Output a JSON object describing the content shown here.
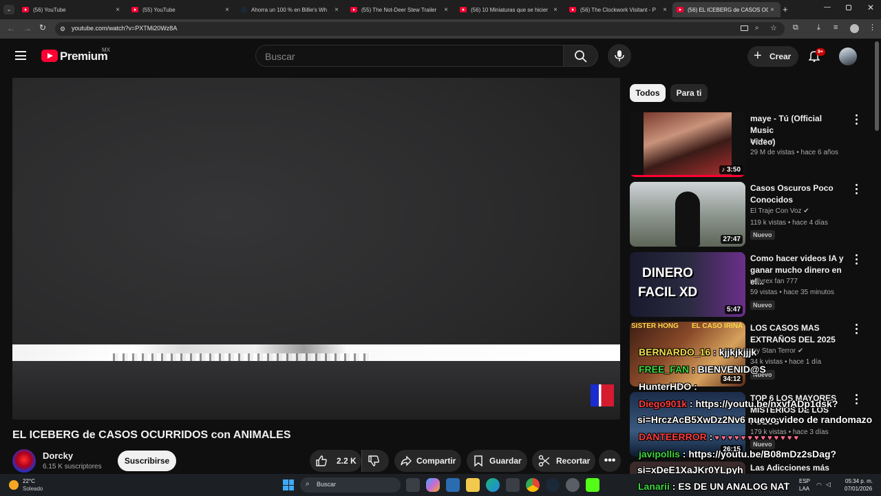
{
  "browser": {
    "tabs": [
      {
        "title": "(56) YouTube",
        "favicon": "youtube-icon",
        "active": false
      },
      {
        "title": "(55) YouTube",
        "favicon": "youtube-icon",
        "active": false
      },
      {
        "title": "Ahorra un 100 % en Billie's Wh",
        "favicon": "steam-icon",
        "active": false
      },
      {
        "title": "(55) The Not-Deer Stew Trailer",
        "favicon": "youtube-icon",
        "active": false
      },
      {
        "title": "(56) 10 Miniaturas que se hicier",
        "favicon": "youtube-icon",
        "active": false
      },
      {
        "title": "(56) The Clockwork Visitant - P",
        "favicon": "youtube-icon",
        "active": false
      },
      {
        "title": "(56) EL ICEBERG de CASOS OC",
        "favicon": "youtube-icon",
        "active": true
      }
    ],
    "url": "youtube.com/watch?v=PXTMi20Wz8A"
  },
  "header": {
    "logo_text": "Premium",
    "region": "MX",
    "search_placeholder": "Buscar",
    "create_label": "Crear",
    "notifications_badge": "9+"
  },
  "video": {
    "title": "EL ICEBERG de CASOS OCURRIDOS con ANIMALES",
    "channel": "Dorcky",
    "subscribers": "6.15 K suscriptores",
    "subscribe_label": "Suscribirse",
    "likes": "2.2 K",
    "share_label": "Compartir",
    "save_label": "Guardar",
    "clip_label": "Recortar"
  },
  "chips": [
    "Todos",
    "Para ti"
  ],
  "related": [
    {
      "title_line1": "maye - Tú (Official Music",
      "title_line2": "Video)",
      "channel": "maye",
      "verified": true,
      "meta": "29 M de vistas • hace 6 años",
      "duration": "3:50",
      "new": "",
      "music": true
    },
    {
      "title_line1": "Casos Oscuros Poco",
      "title_line2": "Conocidos",
      "channel": "El Traje Con Voz",
      "verified": true,
      "meta": "119 k vistas • hace 4 días",
      "duration": "27:47",
      "new": "Nuevo"
    },
    {
      "title_line1": "Como hacer videos IA y",
      "title_line2": "ganar mucho dinero en el...",
      "channel": "willyrex fan 777",
      "verified": false,
      "meta": "59 vistas • hace 35 minutos",
      "duration": "5:47",
      "new": "Nuevo",
      "thumb_text1": "DINERO",
      "thumb_text2": "FACIL XD"
    },
    {
      "title_line1": "LOS CASOS MAS",
      "title_line2": "EXTRAÑOS DEL 2025",
      "channel": "Try Stan Terror",
      "verified": true,
      "meta": "34 k vistas • hace 1 día",
      "duration": "34:12",
      "new": "Nuevo",
      "thumb_text1": "SISTER HONG",
      "thumb_text2": "EL CASO IRINA"
    },
    {
      "title_line1": "TOP 6 LOS MAYORES",
      "title_line2": "MISTERIOS DE LOS POLOS",
      "channel": "",
      "verified": false,
      "meta": "179 k vistas • hace 3 días",
      "duration": "26:15",
      "new": "Nuevo"
    },
    {
      "title_line1": "Las Adicciones más",
      "title_line2": "",
      "channel": "",
      "verified": false,
      "meta": "",
      "duration": "",
      "new": ""
    }
  ],
  "chat": [
    {
      "user": "BERNARDO_16",
      "text": " : kjjkjkjjjk",
      "color": "#f3e04a"
    },
    {
      "user": "FREE_FAN",
      "text": " : BIENVENID@S",
      "color": "#3fd63f"
    },
    {
      "user": "HunterHDO",
      "text": " :",
      "color": "#ffffff"
    },
    {
      "user": "Diego901k",
      "text": " : https://youtu.be/nxvfADp1dsk?",
      "color": "#ff3b3b"
    },
    {
      "user": "",
      "text": "si=HrczAcB5XwDz2Nv6 nuevo video de randomazo",
      "color": "#ffffff"
    },
    {
      "user": "DANTEERROR",
      "text": " :",
      "color": "#ff3b3b"
    },
    {
      "user": "javipollis",
      "text": " : https://youtu.be/B08mDz2sDag?",
      "color": "#3fd63f"
    },
    {
      "user": "",
      "text": "si=xDeE1XaJKr0YLpyh",
      "color": "#ffffff"
    },
    {
      "user": "Lanarii",
      "text": " : ES DE UN ANALOG NAT",
      "color": "#3fd63f"
    }
  ],
  "taskbar": {
    "temperature": "22°C",
    "weather": "Soleado",
    "search_label": "Buscar",
    "language": "ESP",
    "layout": "LAA",
    "time": "05:34 p. m.",
    "date": "07/01/2026"
  },
  "colors": {
    "accent": "#ff0033",
    "background": "#0f0f0f",
    "badge": "#cc0000"
  }
}
